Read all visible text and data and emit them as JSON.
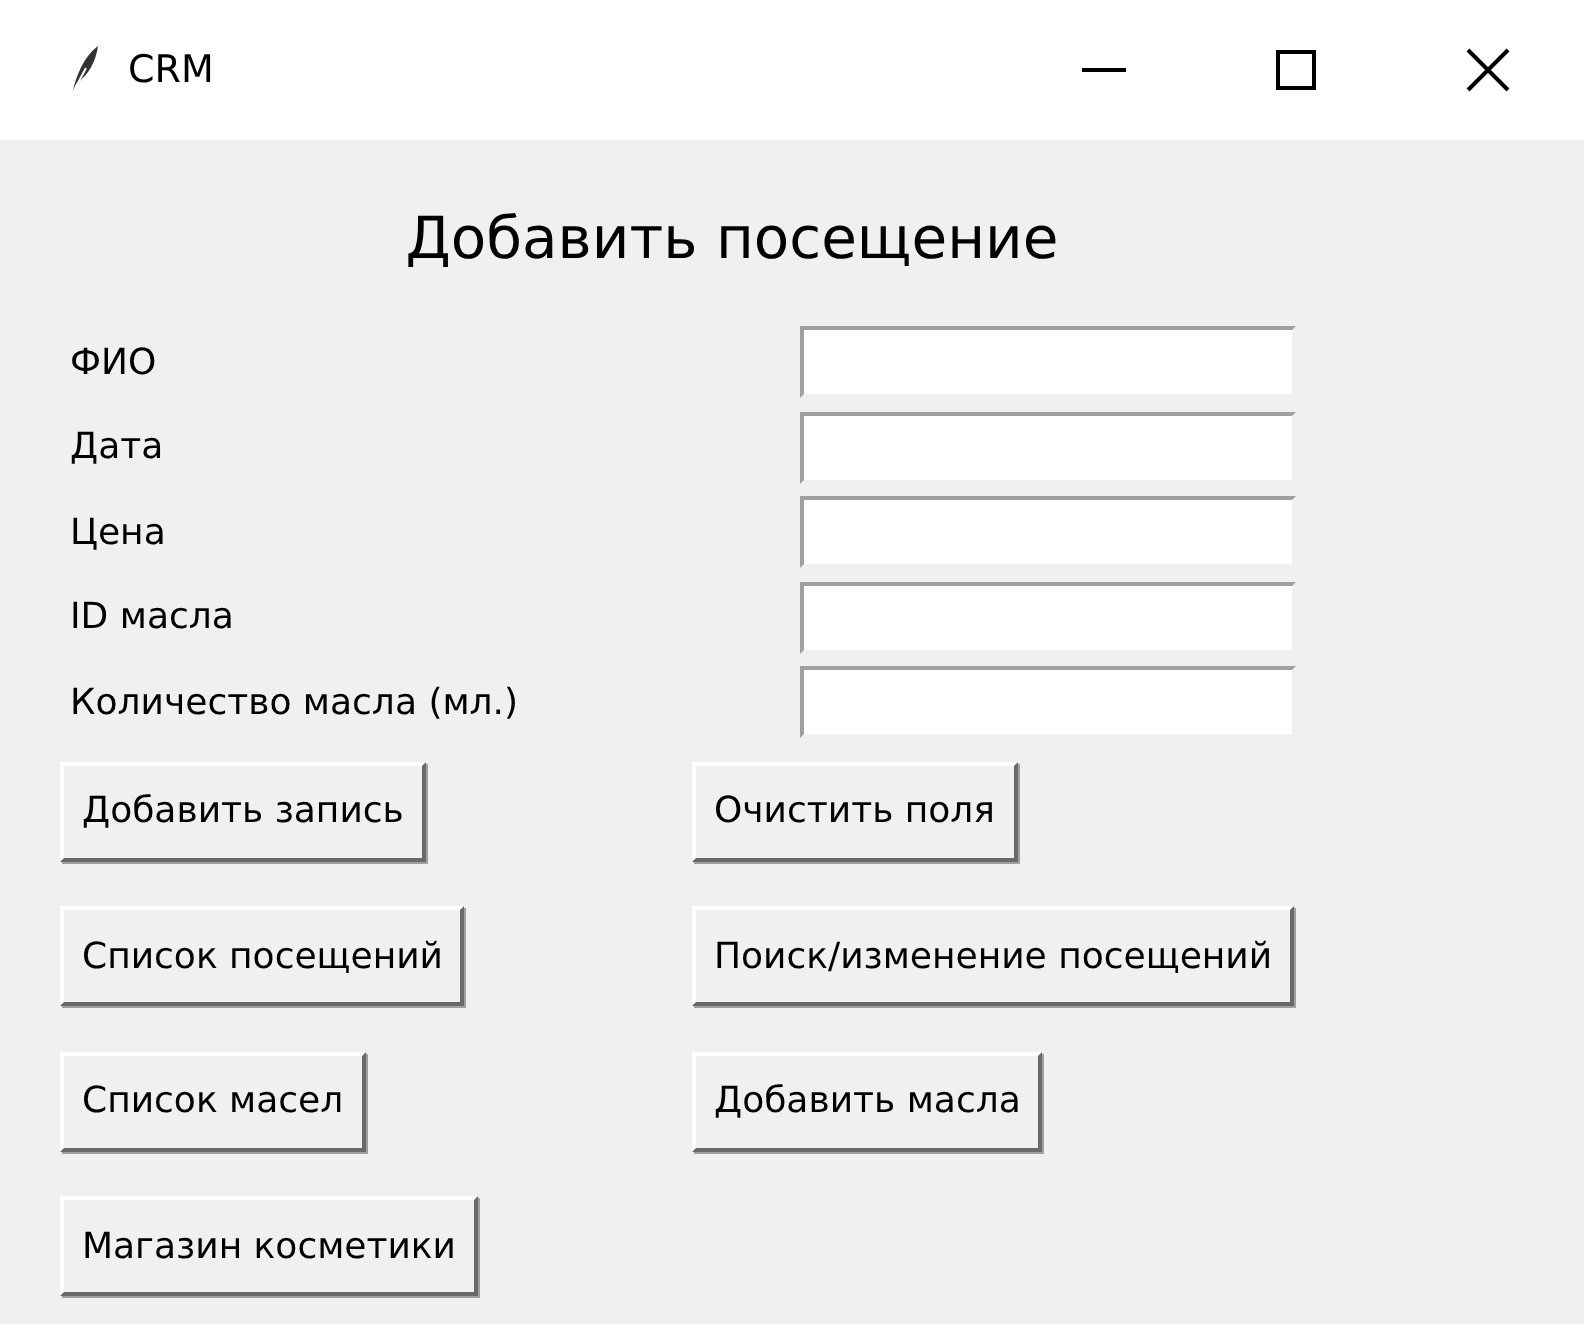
{
  "window": {
    "title": "CRM"
  },
  "heading": "Добавить посещение",
  "fields": [
    {
      "label": "ФИО"
    },
    {
      "label": "Дата"
    },
    {
      "label": "Цена"
    },
    {
      "label": "ID масла"
    },
    {
      "label": "Количество масла (мл.)"
    }
  ],
  "button_rows": [
    [
      "Добавить запись",
      "Очистить поля"
    ],
    [
      "Список посещений",
      "Поиск/изменение посещений"
    ],
    [
      "Список масел",
      "Добавить масла"
    ],
    [
      "Магазин косметики"
    ]
  ]
}
